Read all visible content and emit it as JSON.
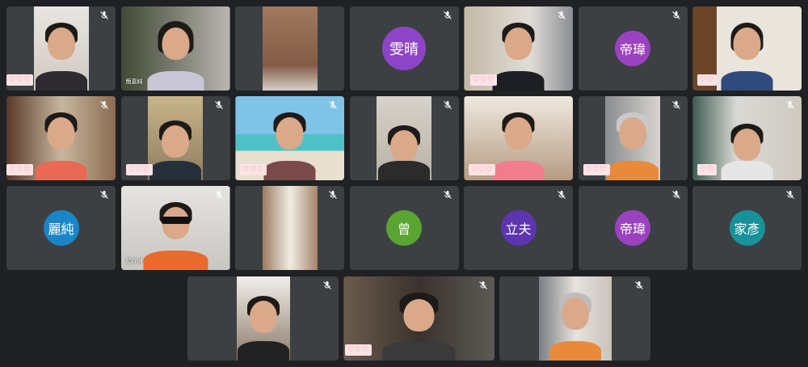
{
  "app": {
    "title": "Video meeting gallery view"
  },
  "participants": [
    {
      "kind": "video",
      "hearts": "♡♡♡"
    },
    {
      "kind": "video",
      "caption": "簡嘉純"
    },
    {
      "kind": "video"
    },
    {
      "kind": "avatar",
      "label": "雯晴",
      "color": "#8e44c6"
    },
    {
      "kind": "video",
      "hearts": "♡♡♡"
    },
    {
      "kind": "avatar",
      "label": "帝瑋",
      "color": "#9b42c0"
    },
    {
      "kind": "video",
      "hearts": "♡♡"
    },
    {
      "kind": "video",
      "hearts": "♡♡♡"
    },
    {
      "kind": "video",
      "hearts": "♡♡♡"
    },
    {
      "kind": "video",
      "hearts": "♡♡♡"
    },
    {
      "kind": "video"
    },
    {
      "kind": "video",
      "hearts": "♡♡♡"
    },
    {
      "kind": "video",
      "hearts": "♡♡♡"
    },
    {
      "kind": "video",
      "hearts": "♡♡"
    },
    {
      "kind": "avatar",
      "label": "麗純",
      "color": "#1a86c8"
    },
    {
      "kind": "video",
      "caption": "藍介洲"
    },
    {
      "kind": "video"
    },
    {
      "kind": "avatar",
      "label": "曾",
      "color": "#5aa532"
    },
    {
      "kind": "avatar",
      "label": "立夫",
      "color": "#5e35b1"
    },
    {
      "kind": "avatar",
      "label": "帝瑋",
      "color": "#9b42c0"
    },
    {
      "kind": "avatar",
      "label": "家彥",
      "color": "#17929a"
    },
    {
      "kind": "video"
    },
    {
      "kind": "video",
      "hearts": "♡♡♡"
    },
    {
      "kind": "video"
    }
  ]
}
